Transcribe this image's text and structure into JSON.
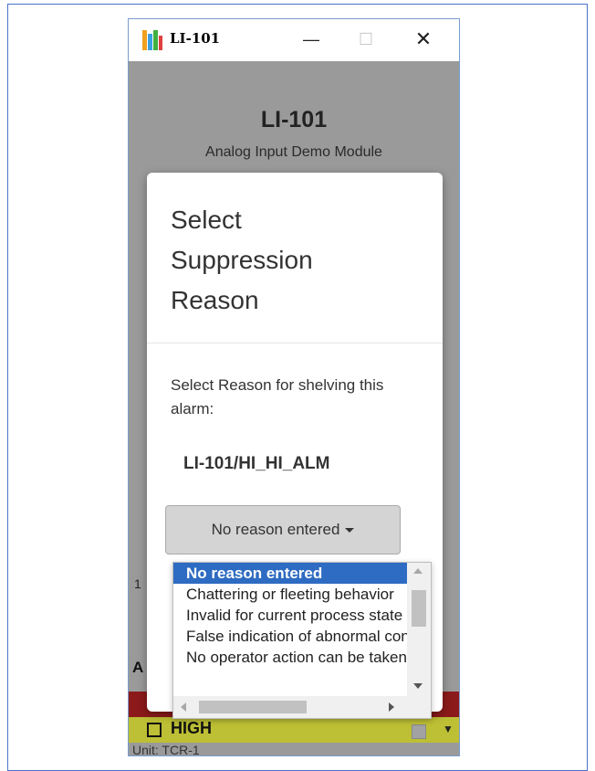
{
  "window": {
    "title": "LI-101",
    "minimize_glyph": "—",
    "maximize_glyph": "☐",
    "close_glyph": "✕"
  },
  "background": {
    "title": "LI-101",
    "subtitle": "Analog Input Demo Module",
    "row_number": "1",
    "section_letter": "A",
    "high_label": "HIGH",
    "unit_text": "Unit: TCR-1"
  },
  "modal": {
    "title_lines": [
      "Select",
      "Suppression",
      "Reason"
    ],
    "prompt": "Select Reason for shelving this alarm:",
    "alarm_name": "LI-101/HI_HI_ALM",
    "dropdown_label": "No reason entered",
    "options": [
      "No reason entered",
      "Chattering or fleeting behavior",
      "Invalid for current process state",
      "False indication of abnormal condition",
      "No operator action can be taken"
    ],
    "selected_index": 0
  },
  "colors": {
    "selected_option": "#2e6bc2",
    "backdrop": "#9a9a9a",
    "alarm_red": "#8c1a1a",
    "alarm_yellow": "#bdbf35"
  },
  "icons": {
    "app": "app-bars-icon",
    "dropdown_caret": "caret-down-icon"
  }
}
